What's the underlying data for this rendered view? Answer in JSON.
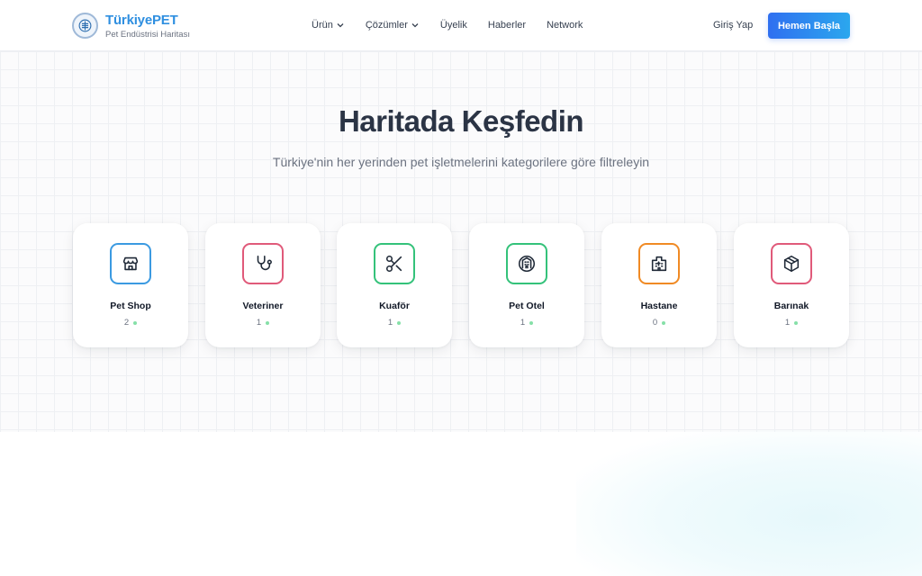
{
  "brand": {
    "name": "TürkiyePET",
    "subtitle": "Pet Endüstrisi Haritası"
  },
  "nav": {
    "items": [
      {
        "label": "Ürün",
        "dropdown": true
      },
      {
        "label": "Çözümler",
        "dropdown": true
      },
      {
        "label": "Üyelik",
        "dropdown": false
      },
      {
        "label": "Haberler",
        "dropdown": false
      },
      {
        "label": "Network",
        "dropdown": false
      }
    ],
    "login_label": "Giriş Yap",
    "cta_label": "Hemen Başla"
  },
  "hero": {
    "title": "Haritada Keşfedin",
    "subtitle": "Türkiye'nin her yerinden pet işletmelerini kategorilere göre filtreleyin"
  },
  "categories": [
    {
      "title": "Pet Shop",
      "count": "2",
      "icon": "store-icon",
      "color": "#3b9ae1"
    },
    {
      "title": "Veteriner",
      "count": "1",
      "icon": "stethoscope-icon",
      "color": "#e05a7a"
    },
    {
      "title": "Kuaför",
      "count": "1",
      "icon": "scissors-icon",
      "color": "#34c27a"
    },
    {
      "title": "Pet Otel",
      "count": "1",
      "icon": "hotel-icon",
      "color": "#34c27a"
    },
    {
      "title": "Hastane",
      "count": "0",
      "icon": "hospital-icon",
      "color": "#f08a24"
    },
    {
      "title": "Barınak",
      "count": "1",
      "icon": "shelter-icon",
      "color": "#e05a7a"
    }
  ],
  "status_dot_color": "#86e0a8"
}
